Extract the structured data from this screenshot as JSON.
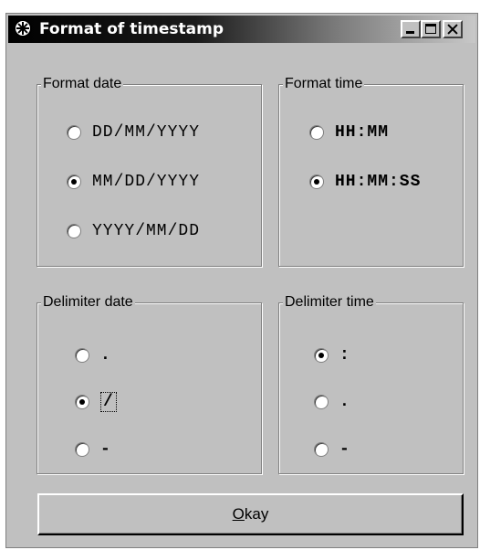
{
  "window": {
    "title": "Format of timestamp",
    "icon": "app-wheel-icon"
  },
  "groups": {
    "format_date": {
      "legend": "Format date",
      "options": [
        {
          "label": "DD/MM/YYYY",
          "checked": false
        },
        {
          "label": "MM/DD/YYYY",
          "checked": true
        },
        {
          "label": "YYYY/MM/DD",
          "checked": false
        }
      ]
    },
    "format_time": {
      "legend": "Format time",
      "options": [
        {
          "label": "HH:MM",
          "checked": false
        },
        {
          "label": "HH:MM:SS",
          "checked": true
        }
      ]
    },
    "delimiter_date": {
      "legend": "Delimiter date",
      "options": [
        {
          "label": ".",
          "checked": false
        },
        {
          "label": "/",
          "checked": true,
          "focused": true
        },
        {
          "label": "-",
          "checked": false
        }
      ]
    },
    "delimiter_time": {
      "legend": "Delimiter time",
      "options": [
        {
          "label": ":",
          "checked": true
        },
        {
          "label": ".",
          "checked": false
        },
        {
          "label": "-",
          "checked": false
        }
      ]
    }
  },
  "okay_button": {
    "accel": "O",
    "rest": "kay"
  }
}
